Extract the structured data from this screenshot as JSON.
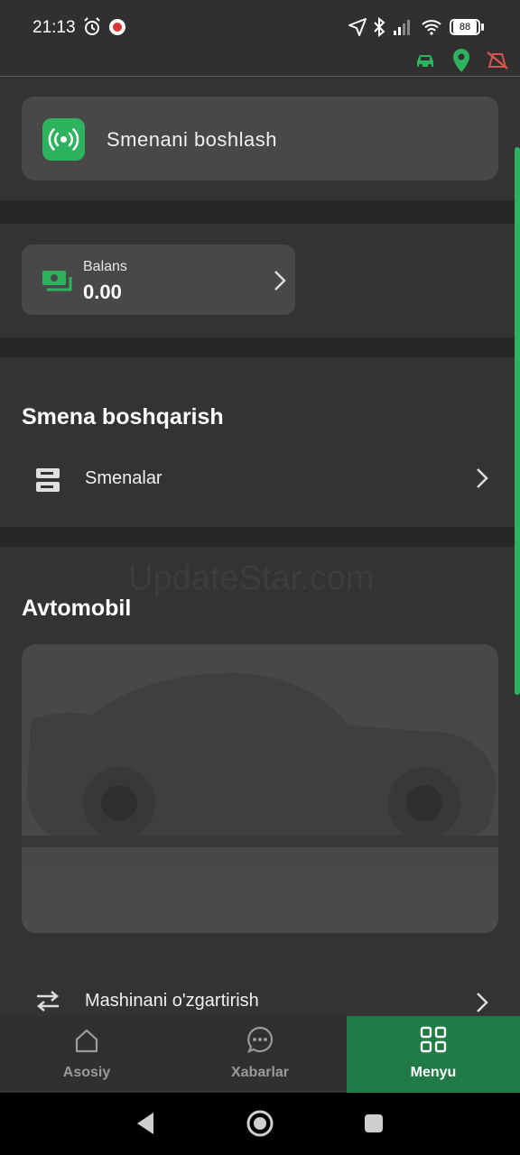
{
  "status": {
    "time": "21:13",
    "battery": "88",
    "icons": [
      "alarm-icon",
      "notification-app-icon",
      "location-arrow-icon",
      "bluetooth-icon",
      "signal-icon",
      "wifi-icon",
      "battery-icon"
    ],
    "indicators": [
      "car-icon",
      "location-pin-icon",
      "no-connection-icon"
    ]
  },
  "shift_button": {
    "label": "Smenani boshlash",
    "icon": "broadcast-icon"
  },
  "balance": {
    "label": "Balans",
    "value": "0.00",
    "icon": "money-icon"
  },
  "shift_management": {
    "title": "Smena boshqarish",
    "items": [
      {
        "label": "Smenalar",
        "icon": "server-icon"
      }
    ]
  },
  "car": {
    "title": "Avtomobil",
    "change_label": "Mashinani o'zgartirish",
    "watermark": "UpdateStar.com"
  },
  "nav": {
    "items": [
      {
        "label": "Asosiy",
        "icon": "home-icon",
        "active": false
      },
      {
        "label": "Xabarlar",
        "icon": "chat-icon",
        "active": false
      },
      {
        "label": "Menyu",
        "icon": "grid-icon",
        "active": true
      }
    ]
  },
  "colors": {
    "accent": "#1f7a45",
    "green": "#2db35d",
    "background": "#303030",
    "card": "#484848",
    "red": "#d9534f"
  }
}
